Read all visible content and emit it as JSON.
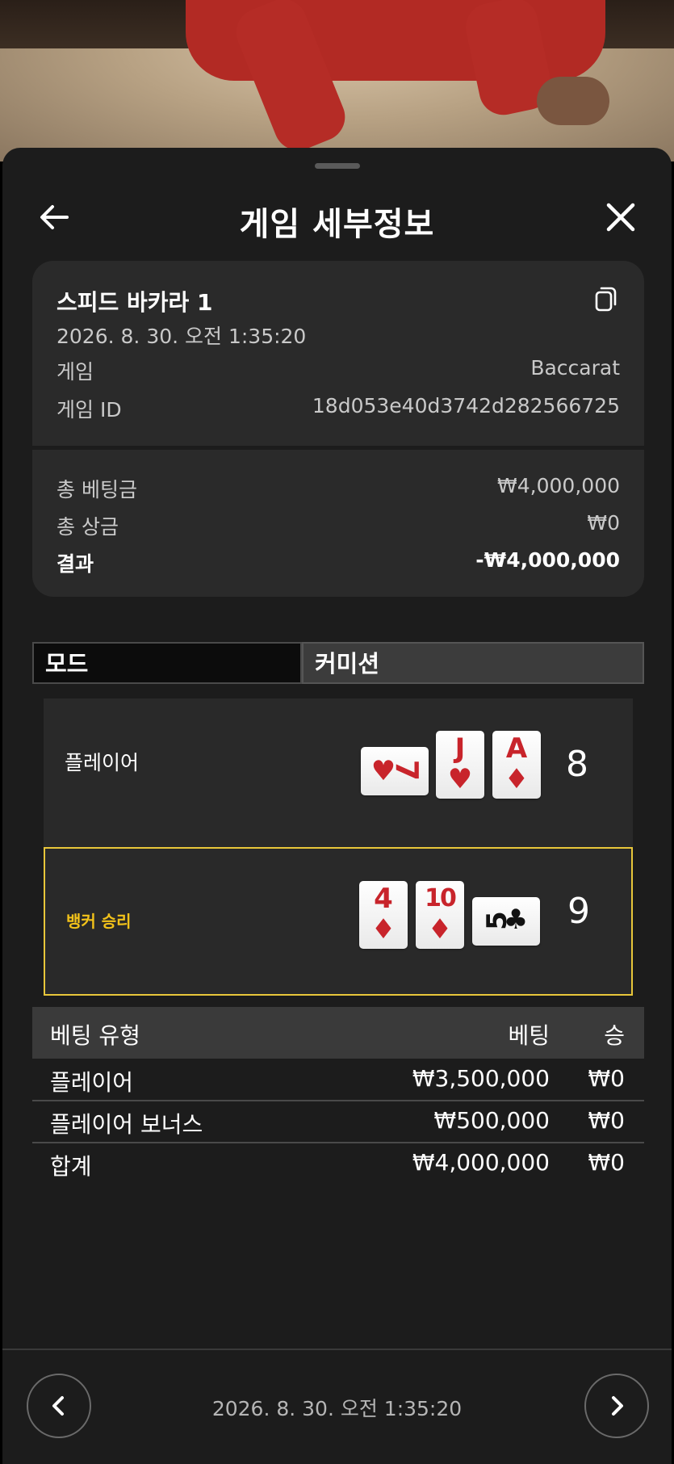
{
  "header": {
    "title": "게임 세부정보"
  },
  "game": {
    "name": "스피드 바카라 1",
    "datetime": "2026. 8. 30. 오전 1:35:20",
    "game_label": "게임",
    "game_value": "Baccarat",
    "id_label": "게임 ID",
    "id_value": "18d053e40d3742d282566725"
  },
  "summary": {
    "total_bet_label": "총 베팅금",
    "total_bet_value": "₩4,000,000",
    "total_prize_label": "총 상금",
    "total_prize_value": "₩0",
    "result_label": "결과",
    "result_value": "-₩4,000,000"
  },
  "tabs": [
    "모드",
    "커미션"
  ],
  "hands": {
    "player": {
      "label": "플레이어",
      "score": "8",
      "cards": [
        {
          "rank": "7",
          "suit": "♥",
          "color": "#c8242b",
          "orientation": "sideways"
        },
        {
          "rank": "J",
          "suit": "♥",
          "color": "#c8242b",
          "orientation": "upright"
        },
        {
          "rank": "A",
          "suit": "♦",
          "color": "#c8242b",
          "orientation": "upright"
        }
      ]
    },
    "banker": {
      "label": "뱅커 승리",
      "score": "9",
      "cards": [
        {
          "rank": "4",
          "suit": "♦",
          "color": "#c8242b",
          "orientation": "upright"
        },
        {
          "rank": "10",
          "suit": "♦",
          "color": "#c8242b",
          "orientation": "upright"
        },
        {
          "rank": "5",
          "suit": "♣",
          "color": "#111111",
          "orientation": "sideways"
        }
      ]
    }
  },
  "bets": {
    "headers": {
      "type": "베팅 유형",
      "bet": "베팅",
      "win": "승"
    },
    "rows": [
      {
        "type": "플레이어",
        "bet": "₩3,500,000",
        "win": "₩0"
      },
      {
        "type": "플레이어 보너스",
        "bet": "₩500,000",
        "win": "₩0"
      },
      {
        "type": "합계",
        "bet": "₩4,000,000",
        "win": "₩0"
      }
    ]
  },
  "footer": {
    "datetime": "2026. 8. 30. 오전 1:35:20"
  },
  "colors": {
    "win_highlight": "#e8c63a",
    "card_red": "#c8242b",
    "sheet_bg": "#1c1c1c"
  }
}
